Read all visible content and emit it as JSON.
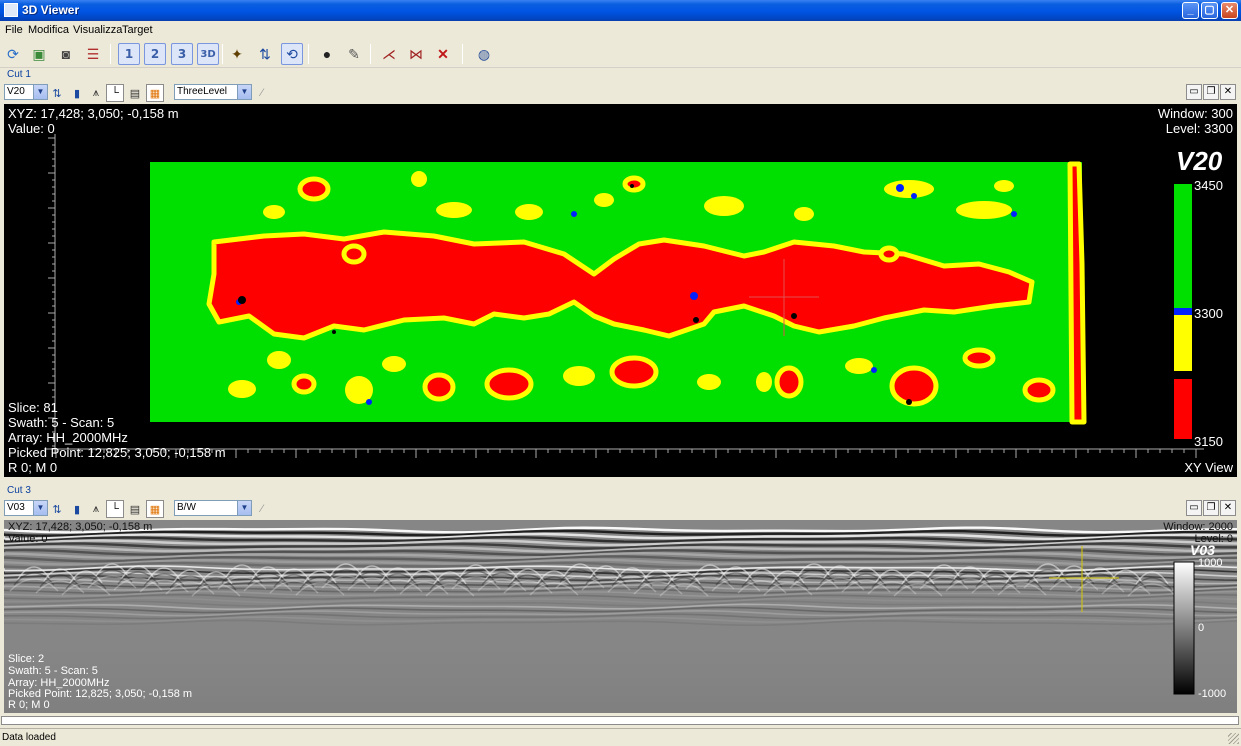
{
  "window": {
    "title": "3D Viewer",
    "minimize": "_",
    "maximize": "▢",
    "close": "✕"
  },
  "menu": [
    "File",
    "Modifica",
    "Visualizza",
    "Target"
  ],
  "toolbar": {
    "view_numbers": [
      "1",
      "2",
      "3",
      "3D"
    ]
  },
  "cut1": {
    "label": "Cut 1",
    "layer_select": "V20",
    "palette_select": "ThreeLevel",
    "xyz": "XYZ:  17,428; 3,050; -0,158 m",
    "value": "Value: 0",
    "window": "Window: 300",
    "level": "Level: 3300",
    "slice": "Slice:  81",
    "swath": "Swath: 5 - Scan: 5",
    "array": "Array: HH_2000MHz",
    "picked": "Picked Point:  12,825; 3,050; -0,158 m",
    "rm": "R 0; M 0",
    "view_type": "XY View",
    "legend_title": "V20",
    "legend_ticks": [
      "3450",
      "3300",
      "3150"
    ],
    "colors": {
      "high": "#00e000",
      "mid": "#ffff00",
      "low": "#ff0000",
      "threshold": "#0020ff"
    }
  },
  "cut3": {
    "label": "Cut 3",
    "layer_select": "V03",
    "palette_select": "B/W",
    "xyz": "XYZ:  17,428; 3,050; -0,158 m",
    "value": "Value: 0",
    "window": "Window: 2000",
    "level": "Level: 0",
    "slice": "Slice:  2",
    "swath": "Swath: 5 - Scan: 5",
    "array": "Array: HH_2000MHz",
    "picked": "Picked Point:  12,825; 3,050; -0,158 m",
    "rm": "R 0; M 0",
    "legend_title": "V03",
    "legend_ticks": [
      "1000",
      "0",
      "-1000"
    ]
  },
  "status": "Data loaded"
}
